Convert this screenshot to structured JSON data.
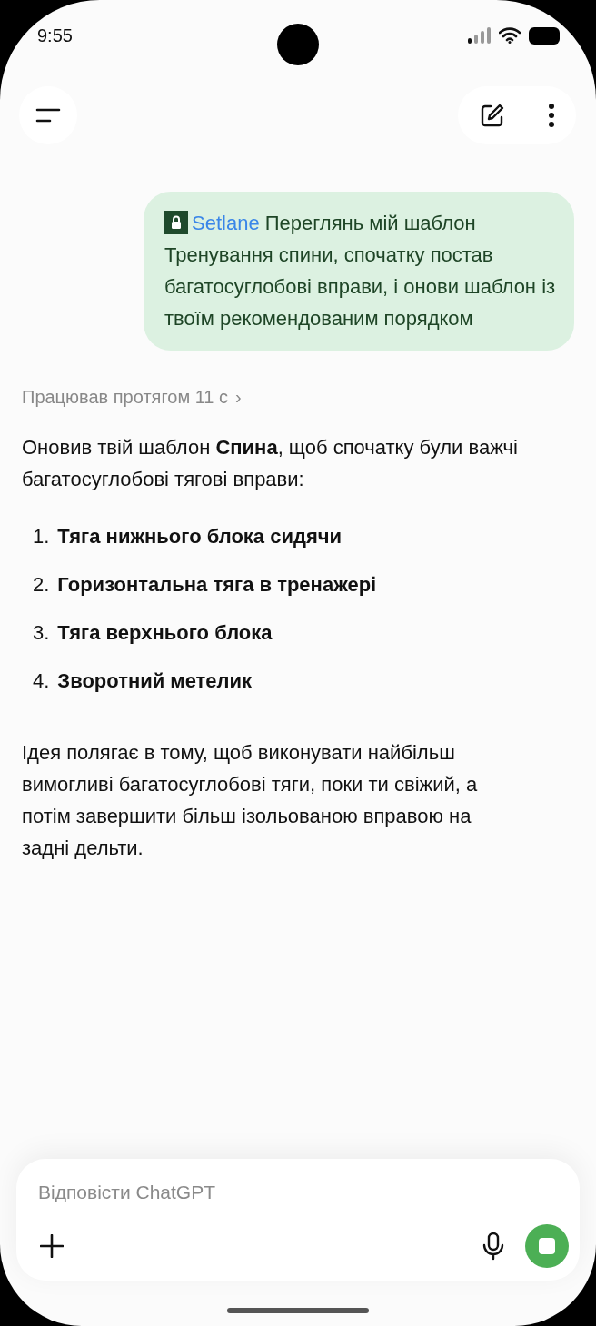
{
  "status_bar": {
    "time": "9:55"
  },
  "user_message": {
    "app": "Setlane",
    "text": "Переглянь мій шаблон Тренування спини, спочатку постав багатосуглобові вправи, і онови шаблон із твоїм рекомендованим порядком"
  },
  "thinking": {
    "label": "Працював протягом 11 с",
    "chevron": "›"
  },
  "reply": {
    "intro": "Оновив твій шаблон **Спина**, щоб спочатку були важчі багатосуглобові тягові вправи:",
    "steps": [
      {
        "number": "1.",
        "text": "Тяга нижнього блока сидячи"
      },
      {
        "number": "2.",
        "text": "Горизонтальна тяга в тренажері"
      },
      {
        "number": "3.",
        "text": "Тяга верхнього блока"
      },
      {
        "number": "4.",
        "text": "Зворотний метелик"
      }
    ],
    "outro": "Ідея полягає в тому, щоб виконувати найбільш вимогливі багатосуглобові тяги, поки ти свіжий, а потім завершити більш ізольованою вправою на задні дельти."
  },
  "composer": {
    "placeholder": "Відповісти ChatGPT",
    "generating": true
  }
}
